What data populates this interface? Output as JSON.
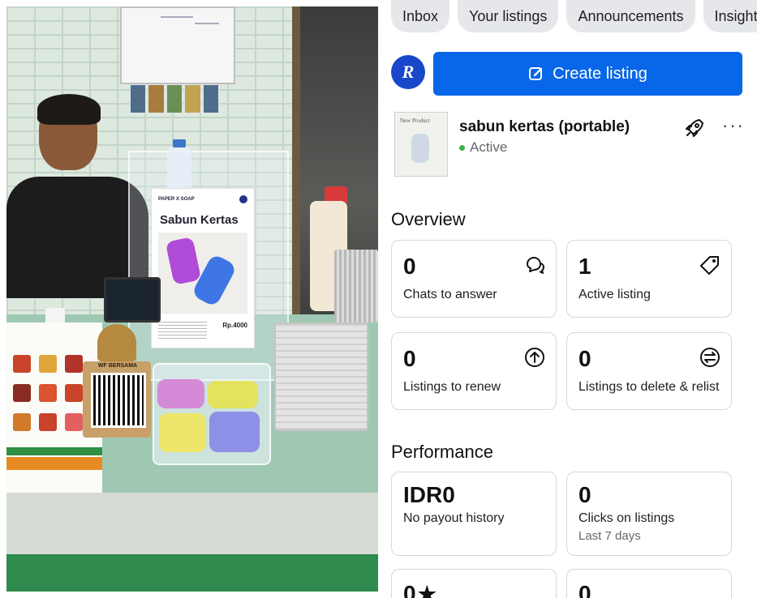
{
  "tabs": [
    "Inbox",
    "Your listings",
    "Announcements",
    "Insights"
  ],
  "create_button": {
    "label": "Create listing",
    "color": "#0866e8"
  },
  "listing": {
    "title": "sabun kertas (portable)",
    "status": "Active",
    "status_color": "#3db34a",
    "thumbnail_text": "New Product"
  },
  "overview": {
    "title": "Overview",
    "cards": [
      {
        "value": "0",
        "label": "Chats to answer",
        "icon": "chat-icon"
      },
      {
        "value": "1",
        "label": "Active listing",
        "icon": "tag-icon"
      },
      {
        "value": "0",
        "label": "Listings to renew",
        "icon": "renew-arrow-icon"
      },
      {
        "value": "0",
        "label": "Listings to delete & relist",
        "icon": "relist-icon"
      }
    ]
  },
  "performance": {
    "title": "Performance",
    "cards": [
      {
        "value": "IDR0",
        "label": "No payout history"
      },
      {
        "value": "0",
        "label": "Clicks on listings",
        "sublabel": "Last 7 days"
      },
      {
        "value": "0",
        "icon": "star-icon"
      },
      {
        "value": "0"
      }
    ]
  },
  "photo": {
    "poster_brand": "PAPER X SOAP",
    "poster_title": "Sabun Kertas",
    "poster_price": "Rp.4000",
    "qr_label": "WF BERSAMA"
  }
}
